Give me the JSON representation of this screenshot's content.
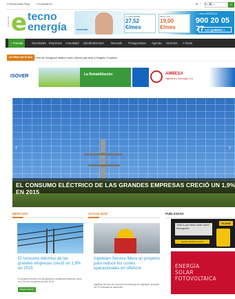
{
  "topbar": {
    "links": [
      "Professionals Blog",
      "Contactanos"
    ],
    "social": "■ ○ ◉ ▣",
    "search_placeholder": "Buscar..."
  },
  "logo": {
    "side_text": "Profesional",
    "letter": "e",
    "line1": "tecno",
    "line2": "energía"
  },
  "header_ad": {
    "brand": "movistar",
    "plan1_label": "Tu Fibra 300Mb",
    "plan1_price": "27,52 €/mes",
    "plan2_label": "Móvil + Fijo",
    "plan2_price": "19,00 €/mes",
    "free_label": "Llama GRATIS al",
    "phone": "900 20 05 77",
    "cta": "LO QUIERO »"
  },
  "nav": {
    "items": [
      "Portada",
      "Novedades",
      "Empresas",
      "Actualidad",
      "Nombramientos",
      "Mercado",
      "Protagonistas",
      "Agenda",
      "Sectores",
      "A fondo"
    ]
  },
  "ticker": {
    "label": "ÚLTIMAS NOTICIAS",
    "text": "Feria de Zaragoza ratifica como director general a Rogelio Cuadrán"
  },
  "banners": {
    "left_brand": "ISOVER",
    "left_text": "La Rehabilitación",
    "right_brand": "AMBESA",
    "right_sub": "Ingeniería y Tecnología, S.A."
  },
  "hero": {
    "caption": "EL CONSUMO ELÉCTRICO DE LAS GRANDES EMPRESAS CRECIÓ UN 1,9% EN 2015",
    "prev": "‹",
    "next": "›"
  },
  "sections": {
    "mercado": {
      "label": "MERCADO",
      "title": "El consumo eléctrico de las grandes empresas creció un 1,9% en 2015",
      "excerpt": "El consumo eléctrico de las grandes y medianas empresas creció un 1,9% en el conjunto del año 2015...",
      "more": "Seguir leyendo"
    },
    "actualidad": {
      "label": "ACTUALIDAD",
      "title": "Ingeteam Service lidera un proyecto para reducir los costes operacionales en offshore",
      "excerpt": "Ingeteam Service es una parte del liderazgo de Ingeteam, proyecto de I+D orientado al desarrollo ..."
    },
    "publicidad": {
      "label": "PUBLICIDAD",
      "ad1_brand": "FLUKE",
      "ad1_text": "Todo lo que debe saber sobre termografía",
      "ad1_btn": "Solicite GRATIS su DVD",
      "ad2_lines": [
        "ENERGÍA",
        "SOLAR",
        "FOTOVOLTAICA"
      ]
    }
  },
  "colors": {
    "accent_green": "#3f9a2a",
    "brand_blue": "#2e8bc9",
    "nav_dark": "#2b2b2b",
    "ticker_orange": "#e07b1a"
  }
}
